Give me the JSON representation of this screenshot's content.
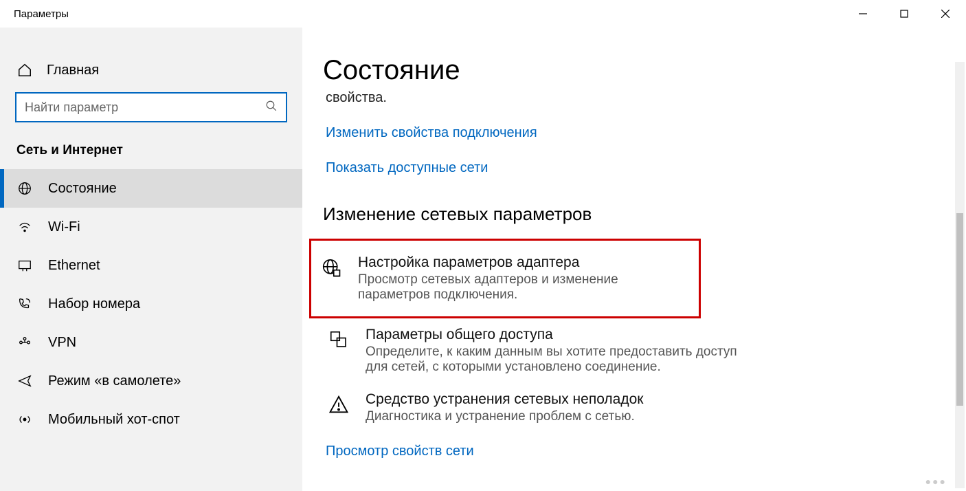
{
  "window": {
    "title": "Параметры"
  },
  "sidebar": {
    "home": "Главная",
    "search_placeholder": "Найти параметр",
    "group": "Сеть и Интернет",
    "items": [
      {
        "label": "Состояние",
        "active": true
      },
      {
        "label": "Wi-Fi"
      },
      {
        "label": "Ethernet"
      },
      {
        "label": "Набор номера"
      },
      {
        "label": "VPN"
      },
      {
        "label": "Режим «в самолете»"
      },
      {
        "label": "Мобильный хот-спот"
      }
    ]
  },
  "main": {
    "title": "Состояние",
    "partial": "свойства.",
    "link_change_props": "Изменить свойства подключения",
    "link_show_networks": "Показать доступные сети",
    "section": "Изменение сетевых параметров",
    "options": [
      {
        "title": "Настройка параметров адаптера",
        "desc": "Просмотр сетевых адаптеров и изменение параметров подключения.",
        "highlight": true
      },
      {
        "title": "Параметры общего доступа",
        "desc": "Определите, к каким данным вы хотите предоставить доступ для сетей, с которыми установлено соединение."
      },
      {
        "title": "Средство устранения сетевых неполадок",
        "desc": "Диагностика и устранение проблем с сетью."
      }
    ],
    "link_view_props": "Просмотр свойств сети"
  }
}
